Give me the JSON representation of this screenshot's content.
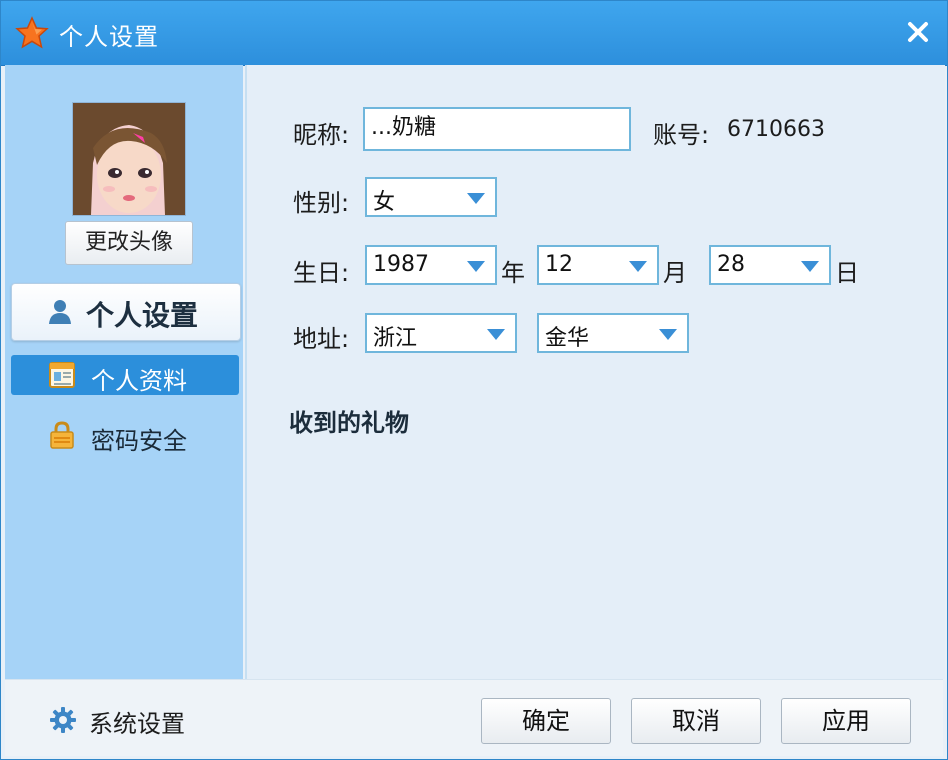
{
  "window": {
    "title": "个人设置",
    "close_icon": "close-icon",
    "brand_color": "#2d8fdc"
  },
  "sidebar": {
    "change_avatar_label": "更改头像",
    "header_label": "个人设置",
    "items": [
      {
        "label": "个人资料",
        "icon": "profile-card-icon",
        "active": true
      },
      {
        "label": "密码安全",
        "icon": "lock-icon",
        "active": false
      }
    ]
  },
  "form": {
    "nickname_label": "昵称:",
    "nickname_value": "...奶糖",
    "account_label": "账号:",
    "account_value": "6710663",
    "gender_label": "性别:",
    "gender_value": "女",
    "birthday_label": "生日:",
    "year_value": "1987",
    "year_unit": "年",
    "month_value": "12",
    "month_unit": "月",
    "day_value": "28",
    "day_unit": "日",
    "address_label": "地址:",
    "province_value": "浙江",
    "city_value": "金华",
    "gifts_title": "收到的礼物"
  },
  "footer": {
    "system_settings_label": "系统设置",
    "ok_label": "确定",
    "cancel_label": "取消",
    "apply_label": "应用"
  }
}
